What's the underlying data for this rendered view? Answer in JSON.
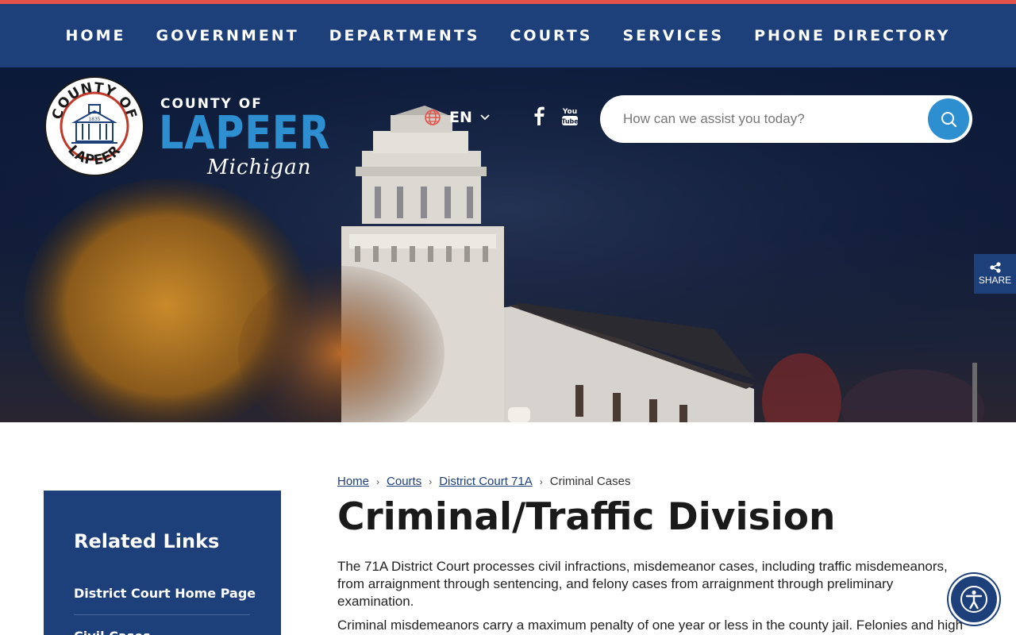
{
  "nav": {
    "items": [
      {
        "label": "HOME"
      },
      {
        "label": "GOVERNMENT"
      },
      {
        "label": "DEPARTMENTS"
      },
      {
        "label": "COURTS"
      },
      {
        "label": "SERVICES"
      },
      {
        "label": "PHONE DIRECTORY"
      }
    ]
  },
  "header": {
    "logo": {
      "county_of": "COUNTY OF",
      "name": "LAPEER",
      "state": "Michigan",
      "seal_top": "COUNTY OF",
      "seal_bottom": "LAPEER",
      "seal_year": "1835"
    },
    "language": {
      "code": "EN",
      "icon": "globe-icon"
    },
    "social": [
      {
        "name": "facebook",
        "icon": "facebook-icon"
      },
      {
        "name": "youtube",
        "icon": "youtube-icon"
      }
    ],
    "search": {
      "placeholder": "How can we assist you today?",
      "icon": "search-icon"
    }
  },
  "share": {
    "label": "SHARE",
    "icon": "share-icon"
  },
  "sidebar": {
    "title": "Related Links",
    "links": [
      {
        "label": "District Court Home Page"
      },
      {
        "label": "Civil Cases"
      }
    ]
  },
  "breadcrumb": {
    "items": [
      {
        "label": "Home"
      },
      {
        "label": "Courts"
      },
      {
        "label": "District Court 71A"
      }
    ],
    "current": "Criminal Cases"
  },
  "main": {
    "title": "Criminal/Traffic Division",
    "paragraphs": [
      "The 71A District Court processes civil infractions, misdemeanor cases, including traffic misdemeanors, from arraignment through sentencing, and felony cases from arraignment through preliminary examination.",
      "Criminal misdemeanors carry a maximum penalty of one year or less in the county jail.  Felonies and high"
    ]
  },
  "accessibility": {
    "icon": "accessibility-icon"
  },
  "colors": {
    "brand_navy": "#1d3f7a",
    "accent_blue": "#2e8fd0",
    "top_strip_red": "#e2524a"
  }
}
